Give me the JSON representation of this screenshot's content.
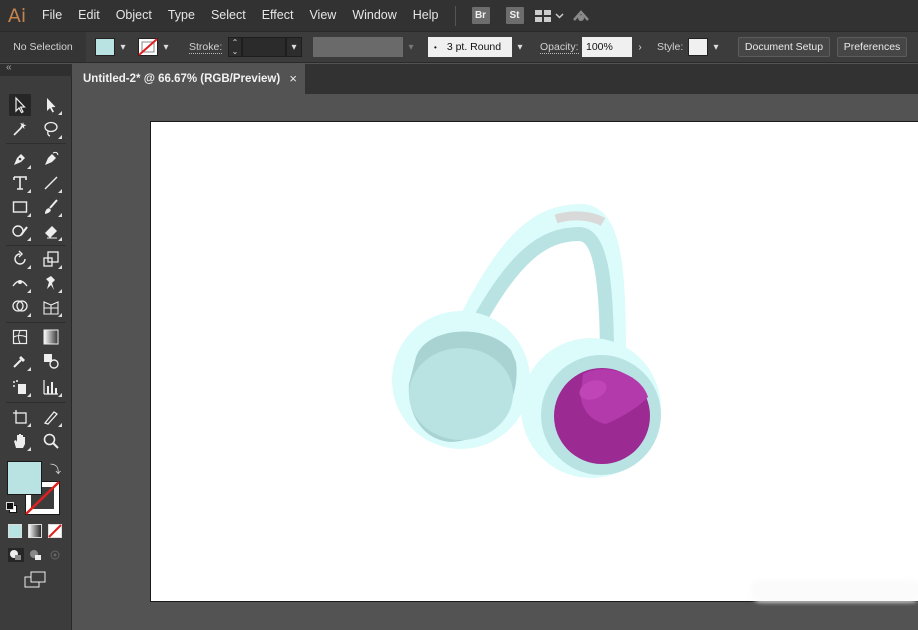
{
  "app": {
    "logo": "Ai"
  },
  "menu": {
    "items": [
      "File",
      "Edit",
      "Object",
      "Type",
      "Select",
      "Effect",
      "View",
      "Window",
      "Help"
    ],
    "bridge": "Br",
    "stock": "St"
  },
  "control": {
    "selection": "No Selection",
    "stroke_label": "Stroke:",
    "brush": "3 pt. Round",
    "opacity_label": "Opacity:",
    "opacity": "100%",
    "style_label": "Style:",
    "document_setup": "Document Setup",
    "preferences": "Preferences"
  },
  "document": {
    "tab_title": "Untitled-2* @ 66.67% (RGB/Preview)",
    "close": "×"
  },
  "colors": {
    "fill": "#b9e3e3",
    "teal_light": "#dcfbfb",
    "teal_mid": "#b9e3e3",
    "teal_dark": "#a9d3d2",
    "purple": "#9c2a93",
    "purple_light": "#b23aab",
    "gray_cap": "#d9d9d9"
  }
}
